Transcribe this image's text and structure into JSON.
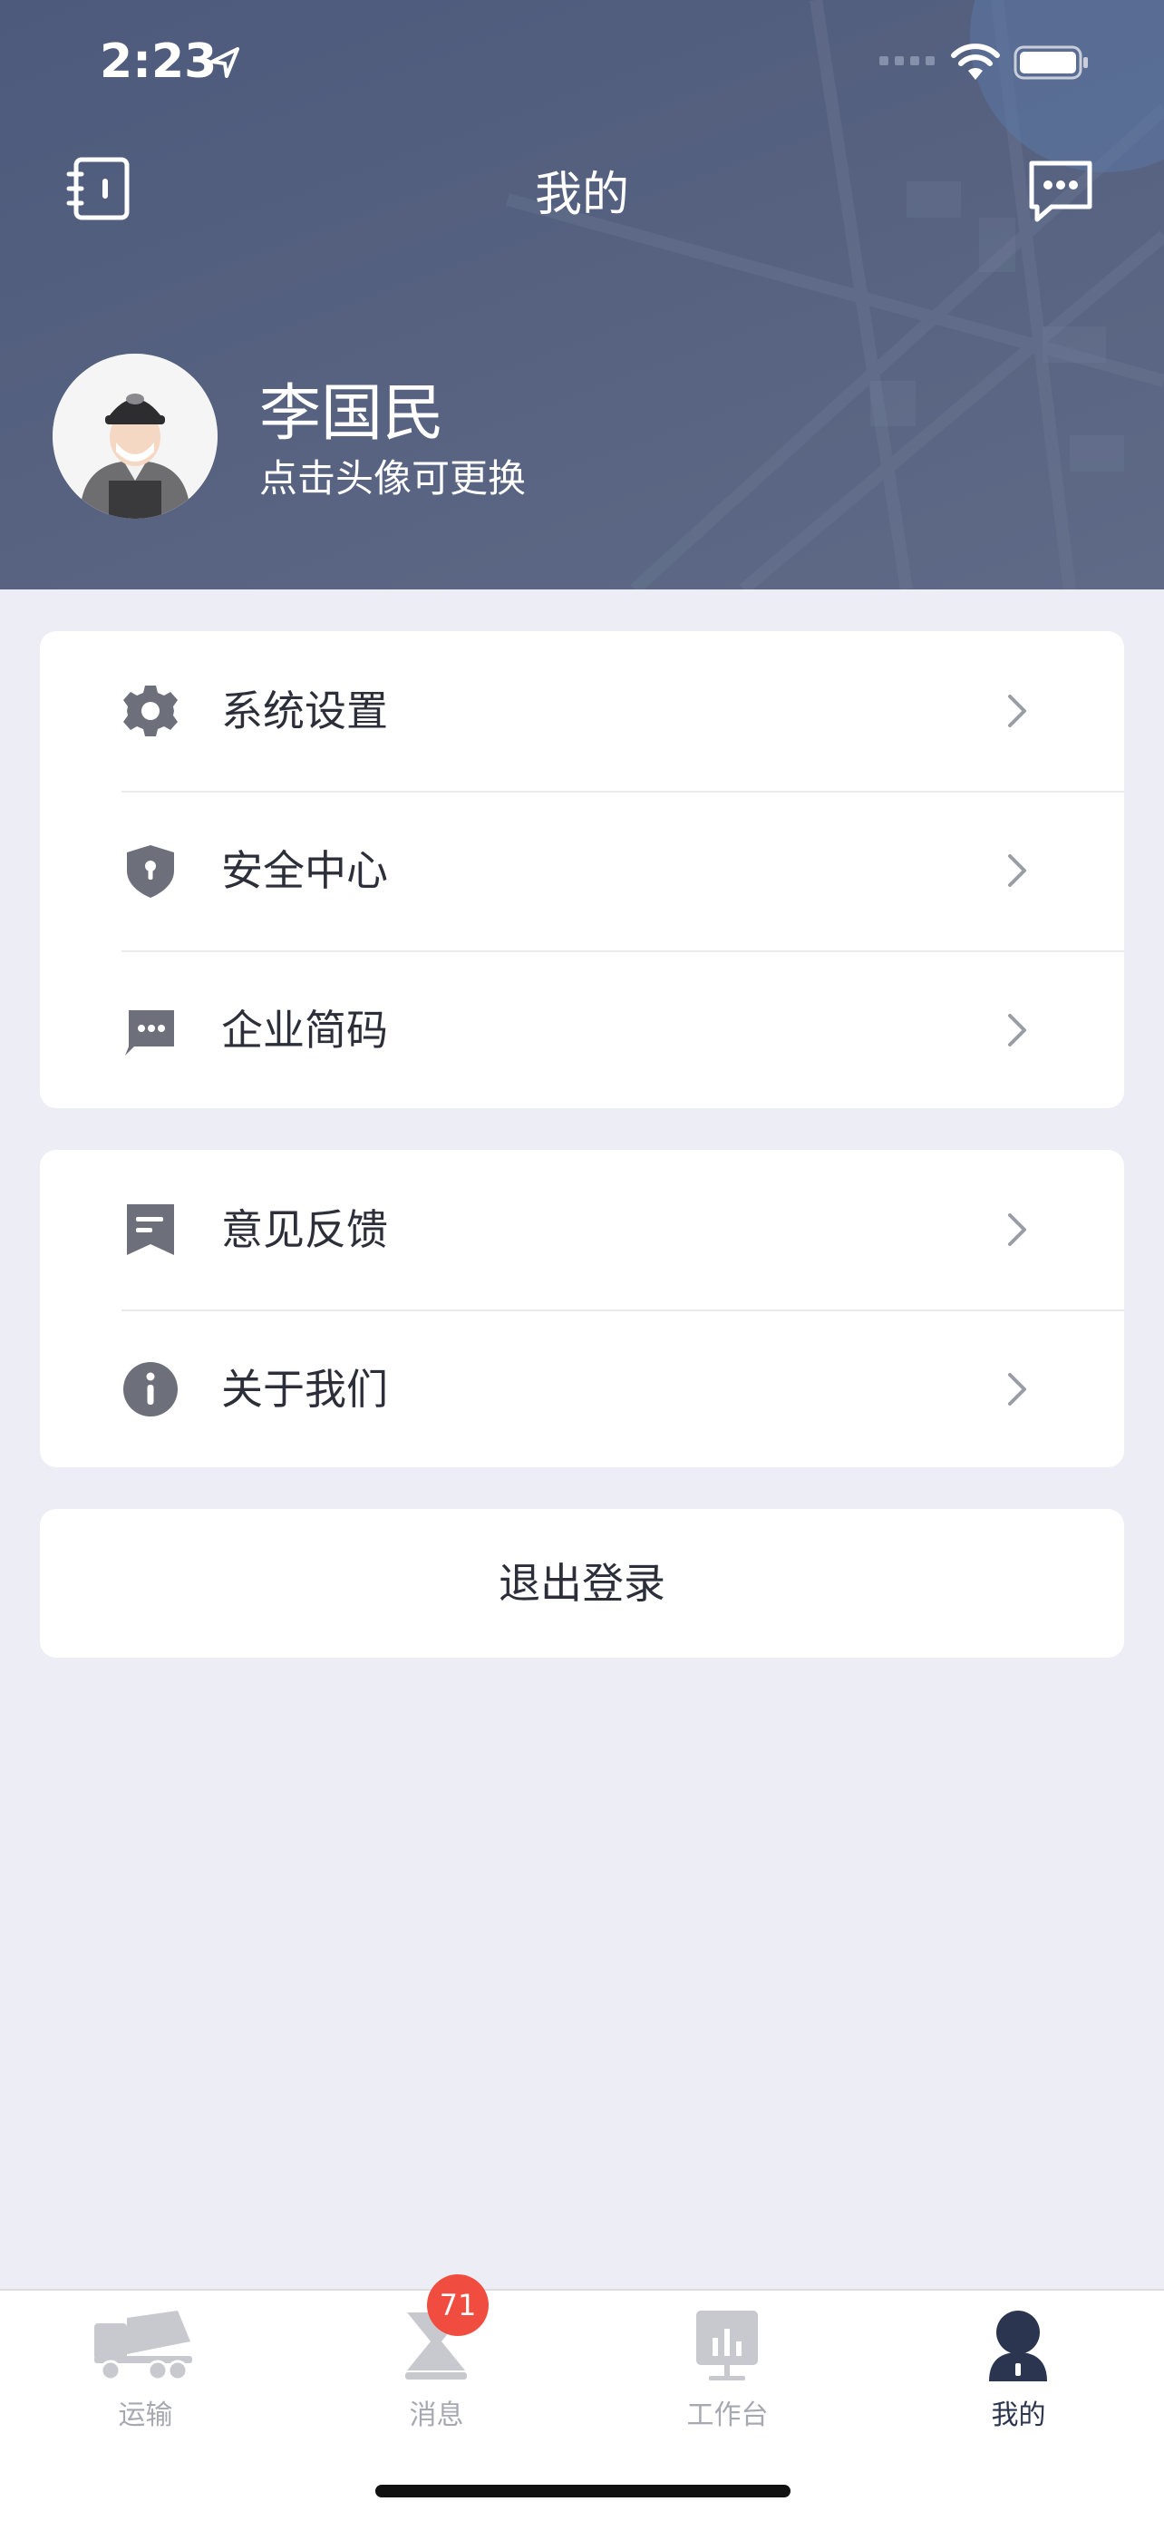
{
  "status_bar": {
    "time": "2:23"
  },
  "header": {
    "title": "我的"
  },
  "profile": {
    "name": "李国民",
    "hint": "点击头像可更换"
  },
  "menu_groups": [
    {
      "items": [
        {
          "label": "系统设置",
          "icon": "gear-icon"
        },
        {
          "label": "安全中心",
          "icon": "shield-icon"
        },
        {
          "label": "企业简码",
          "icon": "chat-bubble-icon"
        }
      ]
    },
    {
      "items": [
        {
          "label": "意见反馈",
          "icon": "feedback-icon"
        },
        {
          "label": "关于我们",
          "icon": "info-icon"
        }
      ]
    }
  ],
  "logout": {
    "label": "退出登录"
  },
  "tabbar": {
    "tabs": [
      {
        "label": "运输",
        "icon": "truck-icon",
        "active": false
      },
      {
        "label": "消息",
        "icon": "message-icon",
        "active": false,
        "badge": "71"
      },
      {
        "label": "工作台",
        "icon": "workbench-icon",
        "active": false
      },
      {
        "label": "我的",
        "icon": "profile-icon",
        "active": true
      }
    ]
  },
  "colors": {
    "header_bg": "#525E7E",
    "page_bg": "#EDEDF6",
    "badge": "#F04C40",
    "active_tab": "#2B3550",
    "inactive_tab": "#A7A9B2"
  }
}
